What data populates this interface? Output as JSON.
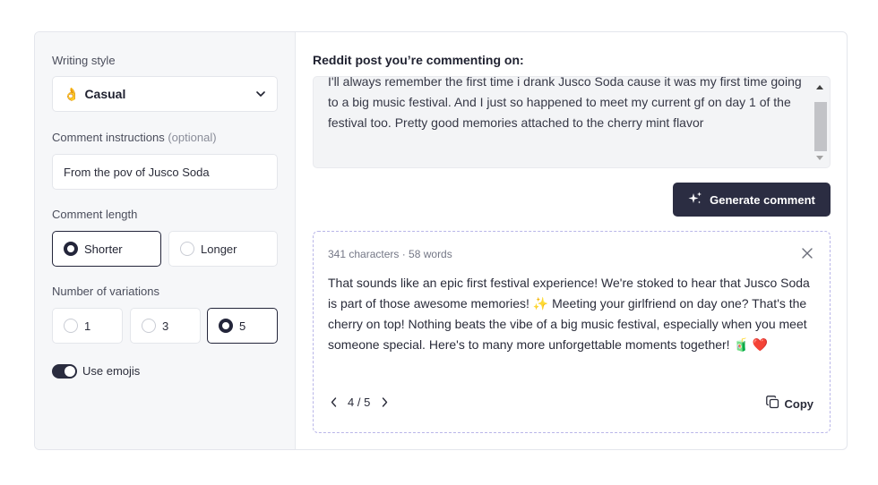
{
  "settings": {
    "writing_style_label": "Writing style",
    "writing_style_emoji": "👌",
    "writing_style_value": "Casual",
    "instructions_label": "Comment instructions",
    "instructions_optional": "(optional)",
    "instructions_value": "From the pov of Jusco Soda",
    "length_label": "Comment length",
    "length_options": [
      "Shorter",
      "Longer"
    ],
    "length_selected": "Shorter",
    "variations_label": "Number of variations",
    "variation_options": [
      "1",
      "3",
      "5"
    ],
    "variations_selected": "5",
    "emoji_toggle_label": "Use emojis",
    "emoji_toggle_on": true
  },
  "post": {
    "title": "Reddit post you’re commenting on:",
    "text": "I'll always remember the first time i drank Jusco Soda cause it was my first time going to a big music festival. And I just so happened to meet my current gf on day 1 of the festival too. Pretty good memories attached to the cherry mint flavor"
  },
  "generate_button_label": "Generate comment",
  "result": {
    "meta": "341 characters · 58 words",
    "comment": "That sounds like an epic first festival experience! We're stoked to hear that Jusco Soda is part of those awesome memories! ✨ Meeting your girlfriend on day one? That's the cherry on top! Nothing beats the vibe of a big music festival, especially when you meet someone special. Here's to many more unforgettable moments together! 🧃 ❤️",
    "pager": "4 / 5",
    "copy_label": "Copy"
  },
  "colors": {
    "accent_dark": "#2b2d42",
    "sparkle": "#f4b400",
    "heart": "#e0245e",
    "dashed_border": "#b9b6e8"
  }
}
